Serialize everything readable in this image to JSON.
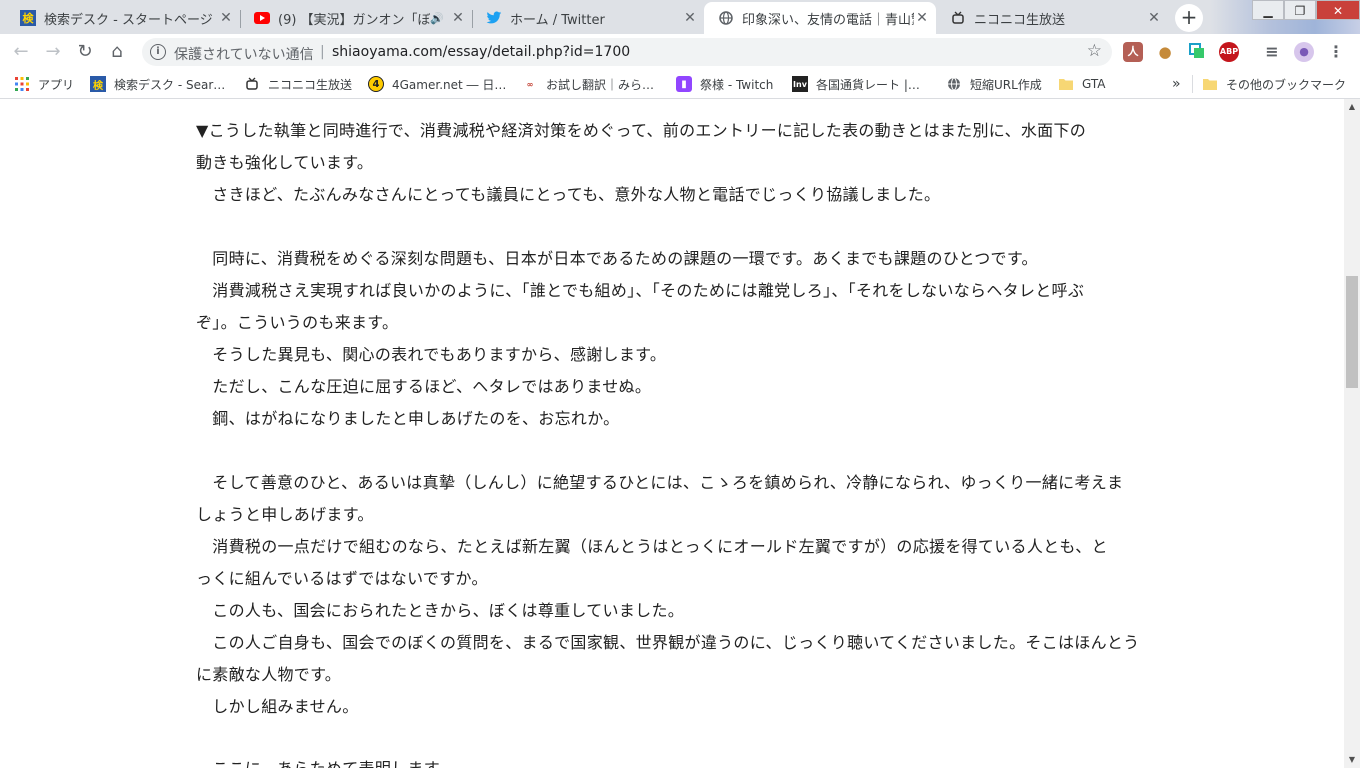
{
  "tabs": [
    {
      "title": "検索デスク - スタートページ",
      "favicon": "kensaku-icon",
      "active": false
    },
    {
      "title": "(9) 【実況】ガンオン「ぼ",
      "favicon": "youtube-icon",
      "active": false,
      "audio": true
    },
    {
      "title": "ホーム / Twitter",
      "favicon": "twitter-icon",
      "active": false
    },
    {
      "title": "印象深い、友情の電話｜青山繁",
      "favicon": "globe-icon",
      "active": true
    },
    {
      "title": "ニコニコ生放送",
      "favicon": "niconico-icon",
      "active": false
    }
  ],
  "new_tab_label": "+",
  "toolbar": {
    "security_text": "保護されていない通信",
    "separator": "|",
    "url": "shiaoyama.com/essay/detail.php?id=1700"
  },
  "bookmarks": [
    {
      "label": "アプリ",
      "icon": "apps-grid-icon"
    },
    {
      "label": "検索デスク - Sear…",
      "icon": "kensaku-icon"
    },
    {
      "label": "ニコニコ生放送",
      "icon": "niconico-icon"
    },
    {
      "label": "4Gamer.net ― 日…",
      "icon": "4gamer-icon"
    },
    {
      "label": "お試し翻訳｜みら…",
      "icon": "translate-icon"
    },
    {
      "label": "祭様 - Twitch",
      "icon": "twitch-icon"
    },
    {
      "label": "各国通貨レート |…",
      "icon": "investing-icon"
    },
    {
      "label": "短縮URL作成",
      "icon": "globe-icon"
    },
    {
      "label": "GTA",
      "icon": "folder-icon"
    }
  ],
  "bookmarks_overflow": "»",
  "other_bookmarks": "その他のブックマーク",
  "article": {
    "lines": [
      "▼こうした執筆と同時進行で、消費減税や経済対策をめぐって、前のエントリーに記した表の動きとはまた別に、水面下の",
      "動きも強化しています。",
      "　さきほど、たぶんみなさんにとっても議員にとっても、意外な人物と電話でじっくり協議しました。",
      "",
      "　同時に、消費税をめぐる深刻な問題も、日本が日本であるための課題の一環です。あくまでも課題のひとつです。",
      "　消費減税さえ実現すれば良いかのように、「誰とでも組め」、「そのためには離党しろ」、「それをしないならヘタレと呼ぶ",
      "ぞ」。こういうのも来ます。",
      "　そうした異見も、関心の表れでもありますから、感謝します。",
      "　ただし、こんな圧迫に屈するほど、ヘタレではありませぬ。",
      "　鋼、はがねになりましたと申しあげたのを、お忘れか。",
      "",
      "　そして善意のひと、あるいは真摯（しんし）に絶望するひとには、こゝろを鎮められ、冷静になられ、ゆっくり一緒に考えま",
      "しょうと申しあげます。",
      "　消費税の一点だけで組むのなら、たとえば新左翼（ほんとうはとっくにオールド左翼ですが）の応援を得ている人とも、と",
      "っくに組んでいるはずではないですか。",
      "　この人も、国会におられたときから、ぼくは尊重していました。",
      "　この人ご自身も、国会でのぼくの質問を、まるで国家観、世界観が違うのに、じっくり聴いてくださいました。そこはほんとう",
      "に素敵な人物です。",
      "　しかし組みません。",
      "",
      "　ここに、あらためて表明します。"
    ]
  }
}
